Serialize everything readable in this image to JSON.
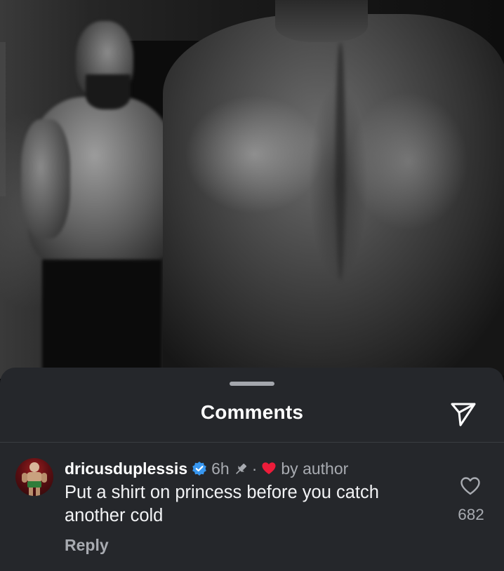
{
  "post_image": {
    "icon": "photo-two-shirtless-men-backstage"
  },
  "comments_sheet": {
    "title": "Comments",
    "share_icon": "paper-plane-icon"
  },
  "comment": {
    "username": "dricusduplessis",
    "verified": true,
    "time": "6h",
    "pinned": true,
    "separator": "·",
    "author_like_label": "by author",
    "text": "Put a shirt on princess before you catch another cold",
    "reply_label": "Reply",
    "like_count": "682"
  },
  "colors": {
    "sheet_bg": "#25272b",
    "verified_blue": "#3897f0",
    "heart_red": "#ed1c3a",
    "muted_text": "#a8abb1"
  }
}
